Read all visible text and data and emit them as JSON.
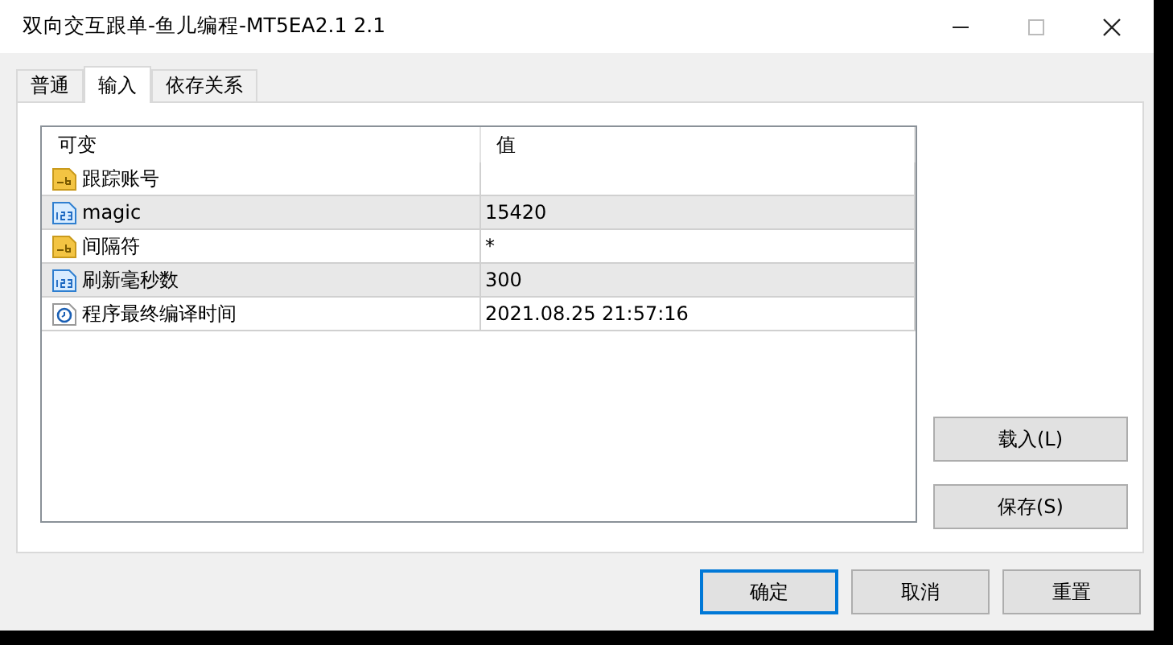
{
  "window": {
    "title": "双向交互跟单-鱼儿编程-MT5EA2.1 2.1"
  },
  "tabs": [
    {
      "label": "普通",
      "selected": false
    },
    {
      "label": "输入",
      "selected": true
    },
    {
      "label": "依存关系",
      "selected": false
    }
  ],
  "table": {
    "columns": [
      "可变",
      "值"
    ],
    "rows": [
      {
        "kind": "string",
        "name": "跟踪账号",
        "value": ""
      },
      {
        "kind": "int",
        "name": "magic",
        "value": "15420"
      },
      {
        "kind": "string",
        "name": "间隔符",
        "value": "*"
      },
      {
        "kind": "int",
        "name": "刷新毫秒数",
        "value": "300"
      },
      {
        "kind": "datetime",
        "name": "程序最终编译时间",
        "value": "2021.08.25 21:57:16"
      }
    ]
  },
  "side_buttons": [
    {
      "label": "载入(L)"
    },
    {
      "label": "保存(S)"
    }
  ],
  "buttons": [
    {
      "label": "确定",
      "default": true
    },
    {
      "label": "取消",
      "default": false
    },
    {
      "label": "重置",
      "default": false
    }
  ]
}
